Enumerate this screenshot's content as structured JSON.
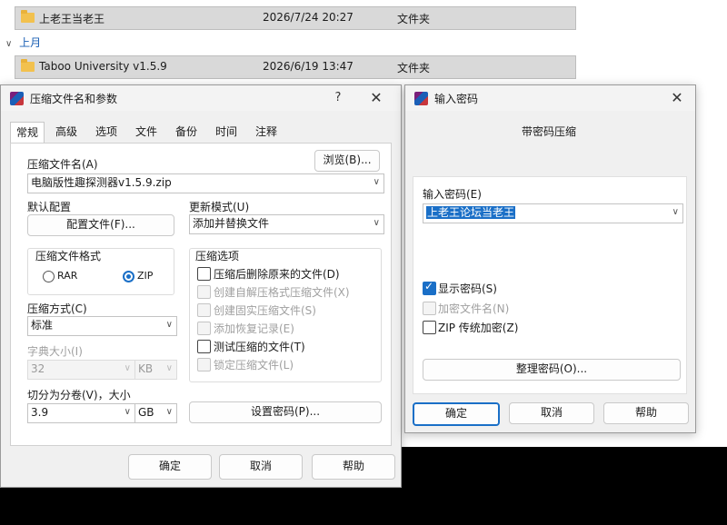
{
  "explorer": {
    "rows": [
      {
        "name": "上老王当老王",
        "date": "2026/7/24 20:27",
        "type": "文件夹"
      },
      {
        "name": "Taboo University v1.5.9",
        "date": "2026/6/19 13:47",
        "type": "文件夹"
      }
    ],
    "group_header": "上月"
  },
  "archive_dialog": {
    "title": "压缩文件名和参数",
    "help_btn": "?",
    "close_btn": "✕",
    "tabs": [
      "常规",
      "高级",
      "选项",
      "文件",
      "备份",
      "时间",
      "注释"
    ],
    "active_tab": "常规",
    "filename_label": "压缩文件名(A)",
    "browse_button": "浏览(B)...",
    "filename_value": "电脑版性趣探测器v1.5.9.zip",
    "default_profile_label": "默认配置",
    "profile_button": "配置文件(F)...",
    "update_mode_label": "更新模式(U)",
    "update_mode_value": "添加并替换文件",
    "format_group_label": "压缩文件格式",
    "format_rar": "RAR",
    "format_zip": "ZIP",
    "selected_format": "ZIP",
    "options_group_label": "压缩选项",
    "options": [
      {
        "label": "压缩后删除原来的文件(D)",
        "checked": false,
        "enabled": true
      },
      {
        "label": "创建自解压格式压缩文件(X)",
        "checked": false,
        "enabled": false
      },
      {
        "label": "创建固实压缩文件(S)",
        "checked": false,
        "enabled": false
      },
      {
        "label": "添加恢复记录(E)",
        "checked": false,
        "enabled": false
      },
      {
        "label": "测试压缩的文件(T)",
        "checked": false,
        "enabled": true
      },
      {
        "label": "锁定压缩文件(L)",
        "checked": false,
        "enabled": false
      }
    ],
    "method_label": "压缩方式(C)",
    "method_value": "标准",
    "dict_label": "字典大小(I)",
    "dict_value": "32",
    "dict_unit": "KB",
    "split_label": "切分为分卷(V)，大小",
    "split_value": "3.9",
    "split_unit": "GB",
    "set_password_button": "设置密码(P)...",
    "ok_button": "确定",
    "cancel_button": "取消",
    "help_button": "帮助"
  },
  "password_dialog": {
    "title": "输入密码",
    "close_btn": "✕",
    "heading": "带密码压缩",
    "password_label": "输入密码(E)",
    "password_value": "上老王论坛当老王",
    "show_password_label": "显示密码(S)",
    "show_password_checked": true,
    "encrypt_names_label": "加密文件名(N)",
    "zip_legacy_label": "ZIP 传统加密(Z)",
    "organize_button": "整理密码(O)...",
    "ok_button": "确定",
    "cancel_button": "取消",
    "help_button": "帮助"
  }
}
